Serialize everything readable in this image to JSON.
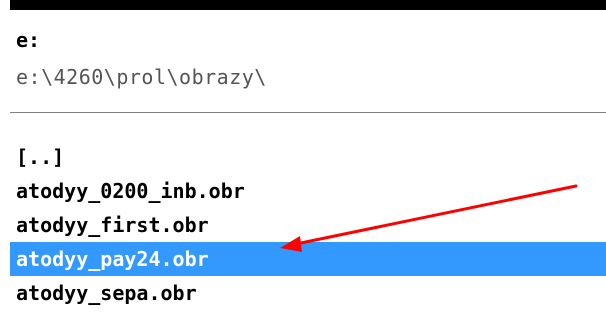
{
  "drive": {
    "label": "e:"
  },
  "path": {
    "value": "e:\\4260\\prol\\obrazy\\"
  },
  "files": [
    {
      "label": "[..]",
      "selected": false
    },
    {
      "label": "atodyy_0200_inb.obr",
      "selected": false
    },
    {
      "label": "atodyy_first.obr",
      "selected": false
    },
    {
      "label": "atodyy_pay24.obr",
      "selected": true
    },
    {
      "label": "atodyy_sepa.obr",
      "selected": false
    }
  ],
  "colors": {
    "selection": "#3399ff",
    "annotation_arrow": "#ff0000"
  },
  "annotation": {
    "icon": "red-arrow-icon",
    "points_to": "atodyy_pay24.obr"
  }
}
